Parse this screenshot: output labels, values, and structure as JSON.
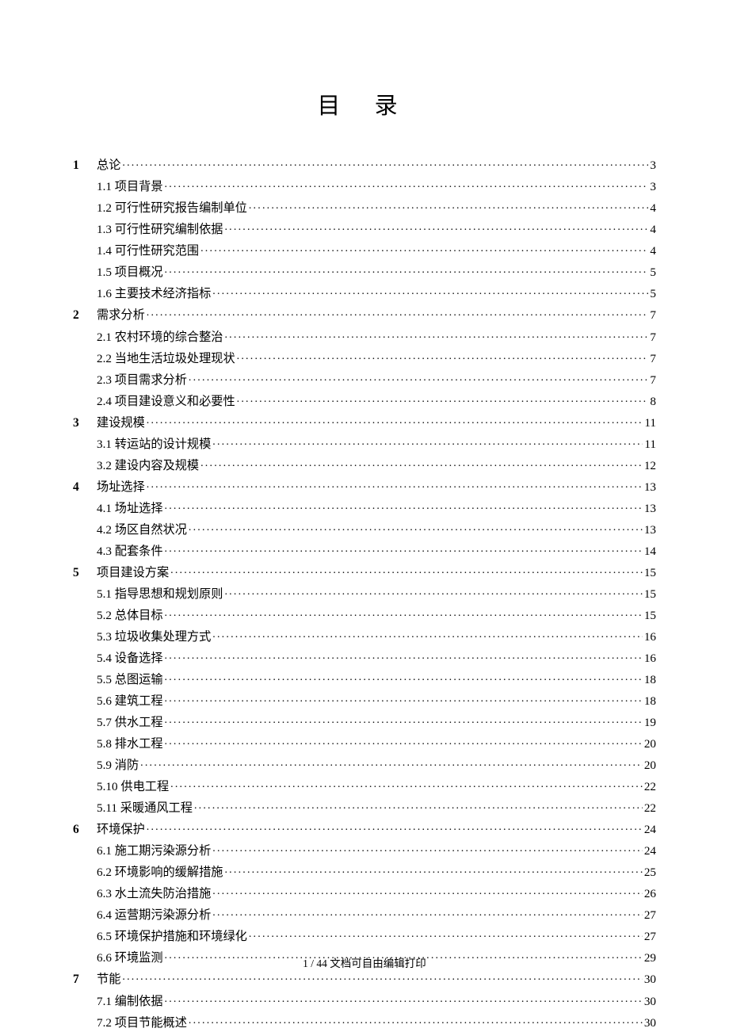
{
  "title": "目 录",
  "footer": "1 / 44 文档可自由编辑打印",
  "toc": [
    {
      "level": 1,
      "num": "1",
      "label": "总论",
      "page": "3"
    },
    {
      "level": 2,
      "num": "",
      "label": "1.1 项目背景",
      "page": "3"
    },
    {
      "level": 2,
      "num": "",
      "label": "1.2 可行性研究报告编制单位",
      "page": "4"
    },
    {
      "level": 2,
      "num": "",
      "label": "1.3 可行性研究编制依据",
      "page": "4"
    },
    {
      "level": 2,
      "num": "",
      "label": "1.4 可行性研究范围",
      "page": "4"
    },
    {
      "level": 2,
      "num": "",
      "label": "1.5 项目概况",
      "page": "5"
    },
    {
      "level": 2,
      "num": "",
      "label": "1.6 主要技术经济指标",
      "page": "5"
    },
    {
      "level": 1,
      "num": "2",
      "label": "需求分析",
      "page": "7"
    },
    {
      "level": 2,
      "num": "",
      "label": "2.1 农村环境的综合整治",
      "page": "7"
    },
    {
      "level": 2,
      "num": "",
      "label": "2.2 当地生活垃圾处理现状",
      "page": "7"
    },
    {
      "level": 2,
      "num": "",
      "label": "2.3 项目需求分析",
      "page": "7"
    },
    {
      "level": 2,
      "num": "",
      "label": "2.4 项目建设意义和必要性",
      "page": "8"
    },
    {
      "level": 1,
      "num": "3",
      "label": "建设规模",
      "page": "11"
    },
    {
      "level": 2,
      "num": "",
      "label": "3.1 转运站的设计规模",
      "page": "11"
    },
    {
      "level": 2,
      "num": "",
      "label": "3.2 建设内容及规模",
      "page": "12"
    },
    {
      "level": 1,
      "num": "4",
      "label": "场址选择",
      "page": "13"
    },
    {
      "level": 2,
      "num": "",
      "label": "4.1 场址选择",
      "page": "13"
    },
    {
      "level": 2,
      "num": "",
      "label": "4.2 场区自然状况",
      "page": "13"
    },
    {
      "level": 2,
      "num": "",
      "label": "4.3 配套条件",
      "page": "14"
    },
    {
      "level": 1,
      "num": "5",
      "label": "项目建设方案",
      "page": "15"
    },
    {
      "level": 2,
      "num": "",
      "label": "5.1 指导思想和规划原则",
      "page": "15"
    },
    {
      "level": 2,
      "num": "",
      "label": "5.2 总体目标",
      "page": "15"
    },
    {
      "level": 2,
      "num": "",
      "label": "5.3 垃圾收集处理方式",
      "page": "16"
    },
    {
      "level": 2,
      "num": "",
      "label": "5.4 设备选择",
      "page": "16"
    },
    {
      "level": 2,
      "num": "",
      "label": "5.5 总图运输",
      "page": "18"
    },
    {
      "level": 2,
      "num": "",
      "label": "5.6 建筑工程",
      "page": "18"
    },
    {
      "level": 2,
      "num": "",
      "label": "5.7 供水工程",
      "page": "19"
    },
    {
      "level": 2,
      "num": "",
      "label": "5.8 排水工程",
      "page": "20"
    },
    {
      "level": 2,
      "num": "",
      "label": "5.9 消防",
      "page": "20"
    },
    {
      "level": 2,
      "num": "",
      "label": "5.10 供电工程",
      "page": "22"
    },
    {
      "level": 2,
      "num": "",
      "label": "5.11 采暖通风工程",
      "page": "22"
    },
    {
      "level": 1,
      "num": "6",
      "label": "环境保护",
      "page": "24"
    },
    {
      "level": 2,
      "num": "",
      "label": "6.1 施工期污染源分析",
      "page": "24"
    },
    {
      "level": 2,
      "num": "",
      "label": "6.2 环境影响的缓解措施",
      "page": "25"
    },
    {
      "level": 2,
      "num": "",
      "label": "6.3 水土流失防治措施",
      "page": "26"
    },
    {
      "level": 2,
      "num": "",
      "label": "6.4 运营期污染源分析",
      "page": "27"
    },
    {
      "level": 2,
      "num": "",
      "label": "6.5 环境保护措施和环境绿化",
      "page": "27"
    },
    {
      "level": 2,
      "num": "",
      "label": "6.6 环境监测",
      "page": "29"
    },
    {
      "level": 1,
      "num": "7",
      "label": "节能",
      "page": "30"
    },
    {
      "level": 2,
      "num": "",
      "label": "7.1 编制依据",
      "page": "30"
    },
    {
      "level": 2,
      "num": "",
      "label": "7.2 项目节能概述",
      "page": "30"
    }
  ]
}
